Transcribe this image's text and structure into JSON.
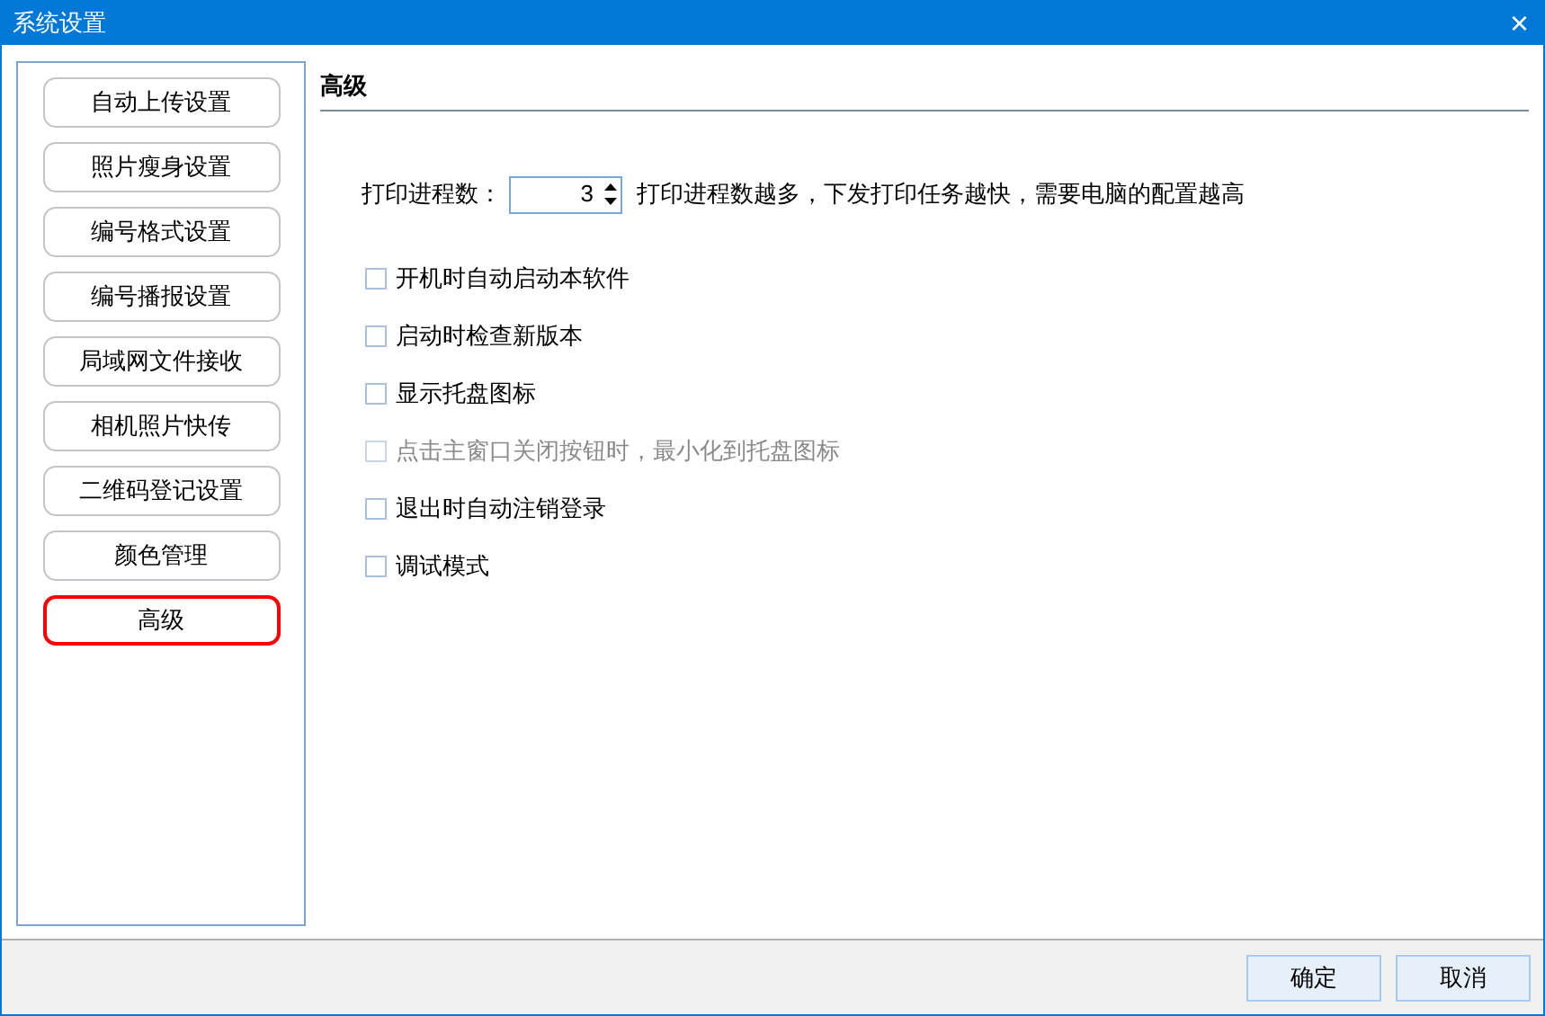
{
  "window": {
    "title": "系统设置",
    "close": "×"
  },
  "sidebar": {
    "items": [
      {
        "label": "自动上传设置",
        "selected": false
      },
      {
        "label": "照片瘦身设置",
        "selected": false
      },
      {
        "label": "编号格式设置",
        "selected": false
      },
      {
        "label": "编号播报设置",
        "selected": false
      },
      {
        "label": "局域网文件接收",
        "selected": false
      },
      {
        "label": "相机照片快传",
        "selected": false
      },
      {
        "label": "二维码登记设置",
        "selected": false
      },
      {
        "label": "颜色管理",
        "selected": false
      },
      {
        "label": "高级",
        "selected": true
      }
    ]
  },
  "panel": {
    "title": "高级",
    "print_processes": {
      "label": "打印进程数：",
      "value": "3",
      "hint": "打印进程数越多，下发打印任务越快，需要电脑的配置越高"
    },
    "options": [
      {
        "label": "开机时自动启动本软件",
        "checked": false,
        "disabled": false
      },
      {
        "label": "启动时检查新版本",
        "checked": false,
        "disabled": false
      },
      {
        "label": "显示托盘图标",
        "checked": false,
        "disabled": false
      },
      {
        "label": "点击主窗口关闭按钮时，最小化到托盘图标",
        "checked": false,
        "disabled": true
      },
      {
        "label": "退出时自动注销登录",
        "checked": false,
        "disabled": false
      },
      {
        "label": "调试模式",
        "checked": false,
        "disabled": false
      }
    ]
  },
  "buttons": [
    "确定",
    "取消"
  ]
}
